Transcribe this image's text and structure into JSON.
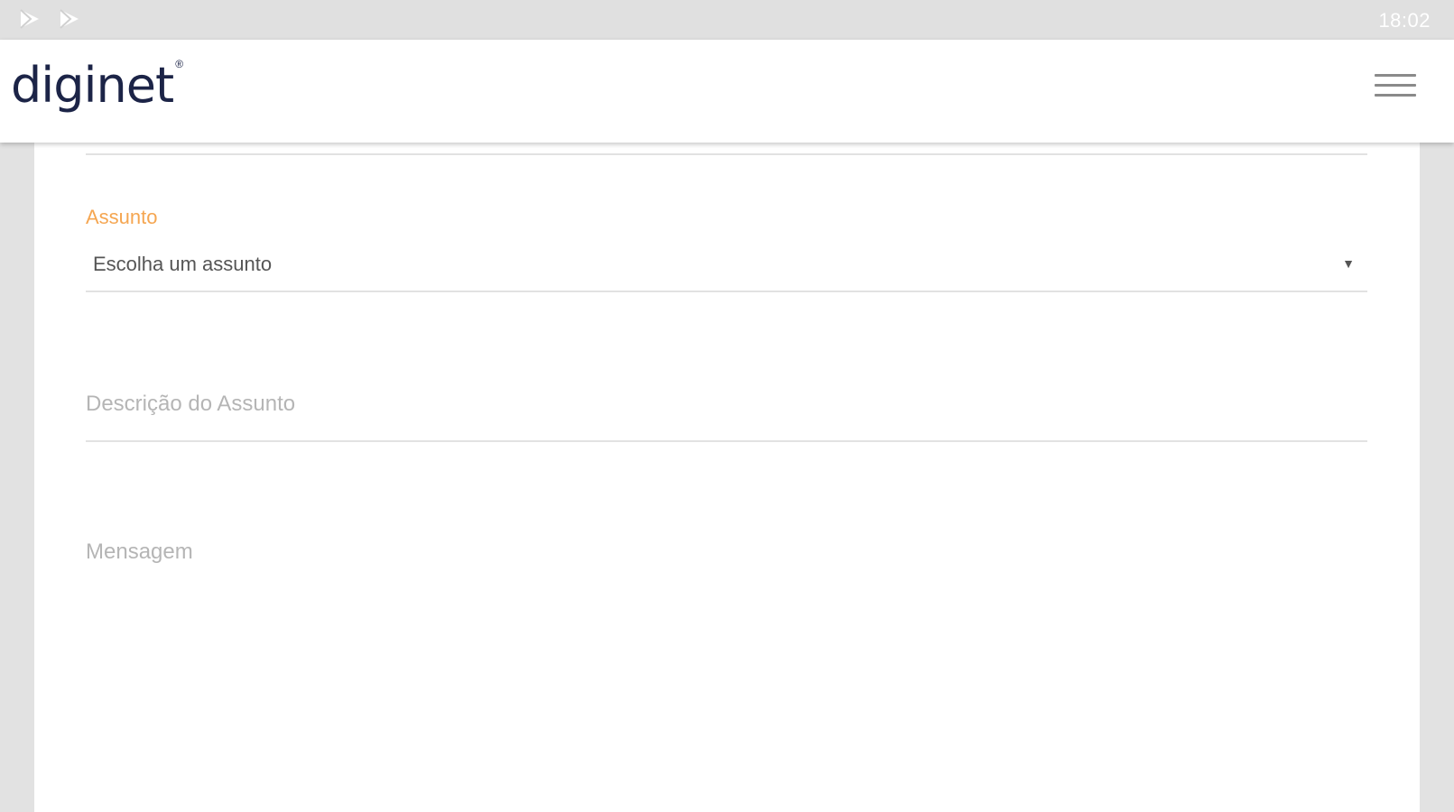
{
  "status_bar": {
    "time": "18:02",
    "icons": [
      "play-store-icon",
      "play-store-icon"
    ]
  },
  "header": {
    "logo_text": "diginet",
    "logo_mark": "®",
    "menu_icon": "hamburger-icon"
  },
  "form": {
    "subject": {
      "label": "Assunto",
      "selected": "Escolha um assunto"
    },
    "subject_description": {
      "placeholder": "Descrição do Assunto"
    },
    "message": {
      "placeholder": "Mensagem"
    }
  },
  "colors": {
    "brand": "#1c2447",
    "label_accent": "#f5a651",
    "status_bar": "#e0e0e0"
  }
}
